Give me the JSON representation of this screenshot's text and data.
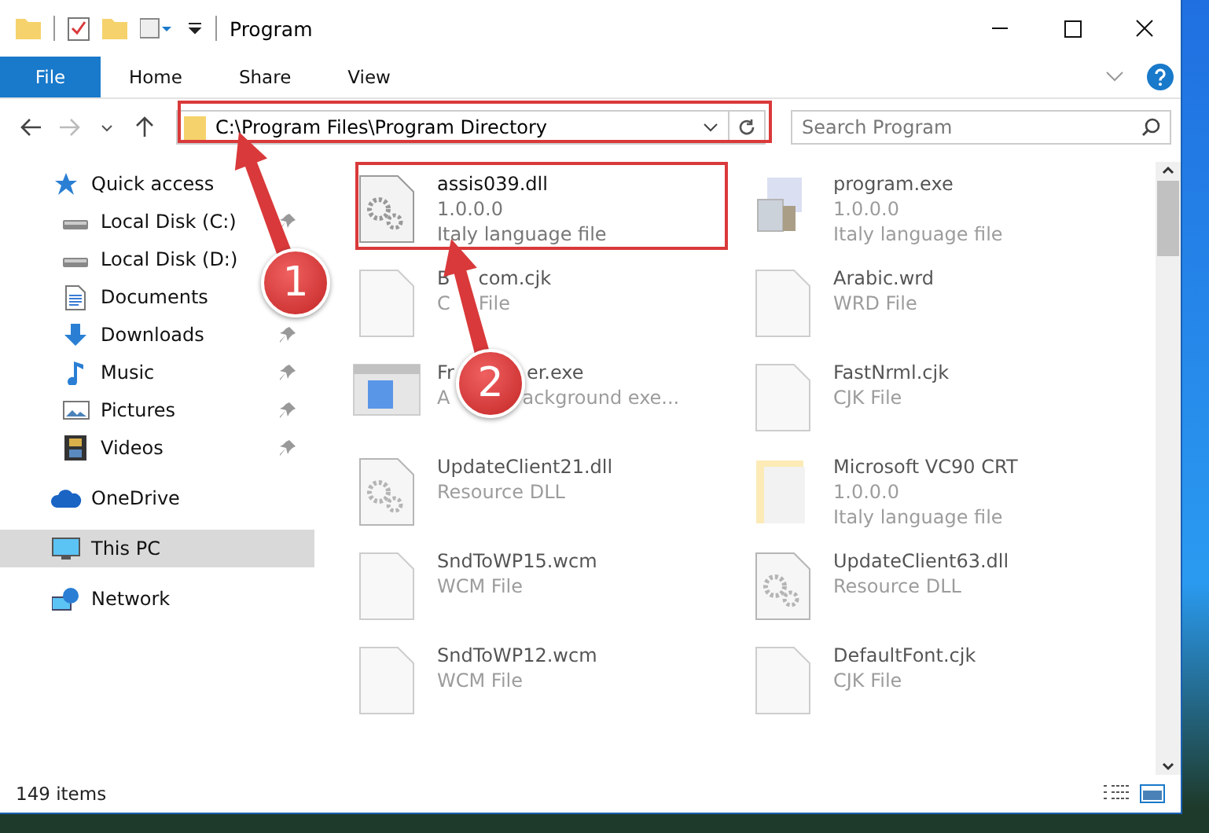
{
  "window": {
    "title": "Program"
  },
  "ribbon": {
    "tabs": [
      {
        "label": "File",
        "kind": "file"
      },
      {
        "label": "Home",
        "kind": "tab"
      },
      {
        "label": "Share",
        "kind": "tab"
      },
      {
        "label": "View",
        "kind": "tab"
      }
    ]
  },
  "address_bar": {
    "path": "C:\\Program Files\\Program Directory"
  },
  "search": {
    "placeholder": "Search Program"
  },
  "nav_pane": {
    "items": [
      {
        "label": "Quick access",
        "kind": "star",
        "selected": false,
        "children": [
          {
            "label": "Local Disk (C:)",
            "kind": "drive",
            "pinned": true,
            "selected": false
          },
          {
            "label": "Local Disk (D:)",
            "kind": "drive",
            "pinned": false,
            "selected": false
          },
          {
            "label": "Documents",
            "kind": "documents",
            "pinned": false,
            "selected": false
          },
          {
            "label": "Downloads",
            "kind": "downloads",
            "pinned": true,
            "selected": false
          },
          {
            "label": "Music",
            "kind": "music",
            "pinned": true,
            "selected": false
          },
          {
            "label": "Pictures",
            "kind": "pictures",
            "pinned": true,
            "selected": false
          },
          {
            "label": "Videos",
            "kind": "videos",
            "pinned": true,
            "selected": false
          }
        ]
      },
      {
        "label": "OneDrive",
        "kind": "cloud",
        "selected": false
      },
      {
        "label": "This PC",
        "kind": "pc",
        "selected": true
      },
      {
        "label": "Network",
        "kind": "network",
        "selected": false
      }
    ]
  },
  "files": [
    {
      "name": "assis039.dll",
      "lines": [
        "1.0.0.0",
        "Italy language file"
      ],
      "kind": "dll",
      "blurred": false
    },
    {
      "name": "program.exe",
      "lines": [
        "1.0.0.0",
        "Italy language file"
      ],
      "kind": "app",
      "blurred": true
    },
    {
      "name": [
        "B",
        "com.cjk"
      ],
      "lines": [
        [
          "C",
          "File"
        ]
      ],
      "kind": "blank",
      "blurred": true,
      "under_badge": false
    },
    {
      "name": "Arabic.wrd",
      "lines": [
        "WRD File"
      ],
      "kind": "blank",
      "blurred": true
    },
    {
      "name": [
        "Fr",
        "er.exe"
      ],
      "lines": [
        [
          "A",
          "ackground exe..."
        ]
      ],
      "kind": "window",
      "blurred": true,
      "under_badge": true
    },
    {
      "name": "FastNrml.cjk",
      "lines": [
        "CJK File"
      ],
      "kind": "blank",
      "blurred": true
    },
    {
      "name": "UpdateClient21.dll",
      "lines": [
        "Resource DLL"
      ],
      "kind": "dll",
      "blurred": true
    },
    {
      "name": "Microsoft VC90 CRT",
      "lines": [
        "1.0.0.0",
        "Italy language file"
      ],
      "kind": "package",
      "blurred": true
    },
    {
      "name": "SndToWP15.wcm",
      "lines": [
        "WCM File"
      ],
      "kind": "blank",
      "blurred": true
    },
    {
      "name": "UpdateClient63.dll",
      "lines": [
        "Resource DLL"
      ],
      "kind": "dll",
      "blurred": true
    },
    {
      "name": "SndToWP12.wcm",
      "lines": [
        "WCM File"
      ],
      "kind": "blank",
      "blurred": true
    },
    {
      "name": "DefaultFont.cjk",
      "lines": [
        "CJK File"
      ],
      "kind": "blank",
      "blurred": true
    }
  ],
  "status_bar": {
    "item_count": "149 items"
  },
  "annotations": [
    {
      "label": "1"
    },
    {
      "label": "2"
    }
  ]
}
